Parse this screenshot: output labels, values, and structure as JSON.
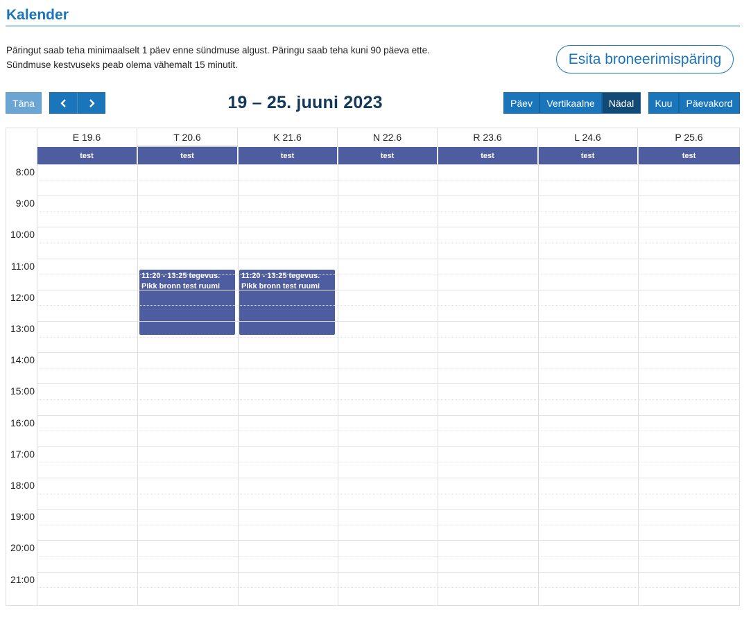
{
  "page": {
    "title": "Kalender",
    "intro_line1": "Päringut saab teha minimaalselt 1 päev enne sündmuse algust. Päringu saab teha kuni 90 päeva ette.",
    "intro_line2": "Sündmuse kestvuseks peab olema vähemalt 15 minutit.",
    "book_button": "Esita broneerimispäring"
  },
  "toolbar": {
    "today": "Täna",
    "prev_icon": "chevron-left-icon",
    "next_icon": "chevron-right-icon",
    "range": "19 – 25. juuni 2023",
    "views": [
      "Päev",
      "Vertikaalne",
      "Nädal"
    ],
    "active_view": "Nädal",
    "views2": [
      "Kuu",
      "Päevakord"
    ]
  },
  "days": [
    "E 19.6",
    "T 20.6",
    "K 21.6",
    "N 22.6",
    "R 23.6",
    "L 24.6",
    "P 25.6"
  ],
  "resource": "test",
  "hours": [
    "8:00",
    "9:00",
    "10:00",
    "11:00",
    "12:00",
    "13:00",
    "14:00",
    "15:00",
    "16:00",
    "17:00",
    "18:00",
    "19:00",
    "20:00",
    "21:00"
  ],
  "events": [
    {
      "day": "T 20.6",
      "text": "11:20 - 13:25 tegevus. Pikk bronn test ruumi"
    },
    {
      "day": "K 21.6",
      "text": "11:20 - 13:25 tegevus. Pikk bronn test ruumi"
    }
  ],
  "colors": {
    "accent": "#1a75bb",
    "event": "#4e5d9f",
    "active_view": "#124a75"
  }
}
